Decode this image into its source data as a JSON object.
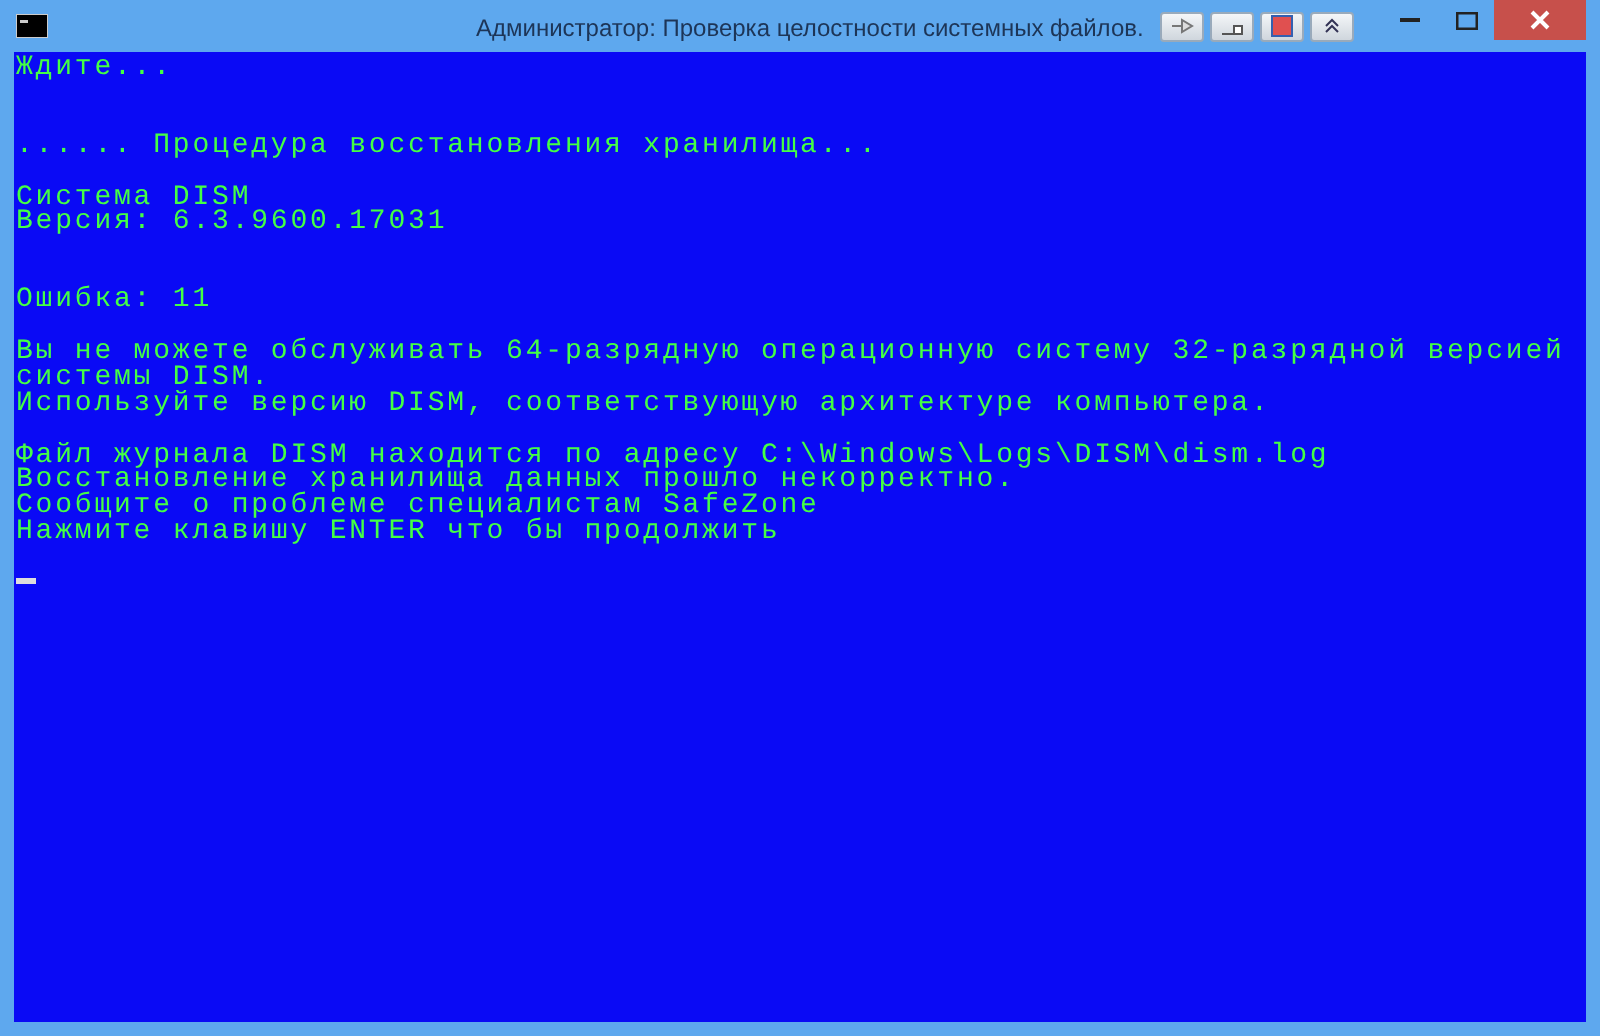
{
  "window": {
    "title": "Администратор:  Проверка целостности системных файлов."
  },
  "console": {
    "blocks": [
      {
        "kind": "opening",
        "lines": [
          "Ждите..."
        ]
      },
      {
        "kind": "section",
        "lines": [
          "...... Процедура восстановления хранилища..."
        ]
      },
      {
        "kind": "paragraph",
        "lines": [
          "Система DISM",
          "Версия: 6.3.9600.17031"
        ]
      },
      {
        "kind": "section",
        "lines": [
          "Ошибка: 11"
        ]
      },
      {
        "kind": "paragraph",
        "lines": [
          "Вы не можете обслуживать 64-разрядную операционную систему 32-разрядной версией",
          "системы DISM.",
          "Используйте версию DISM, соответствующую архитектуре компьютера."
        ]
      },
      {
        "kind": "paragraph",
        "lines": [
          "Файл журнала DISM находится по адресу C:\\Windows\\Logs\\DISM\\dism.log",
          "Восстановление хранилища данных прошло некорректно.",
          "Сообщите о проблеме специалистам SafeZone",
          "Нажмите клавишу ENTER что бы продолжить"
        ]
      }
    ],
    "cursor": true
  }
}
